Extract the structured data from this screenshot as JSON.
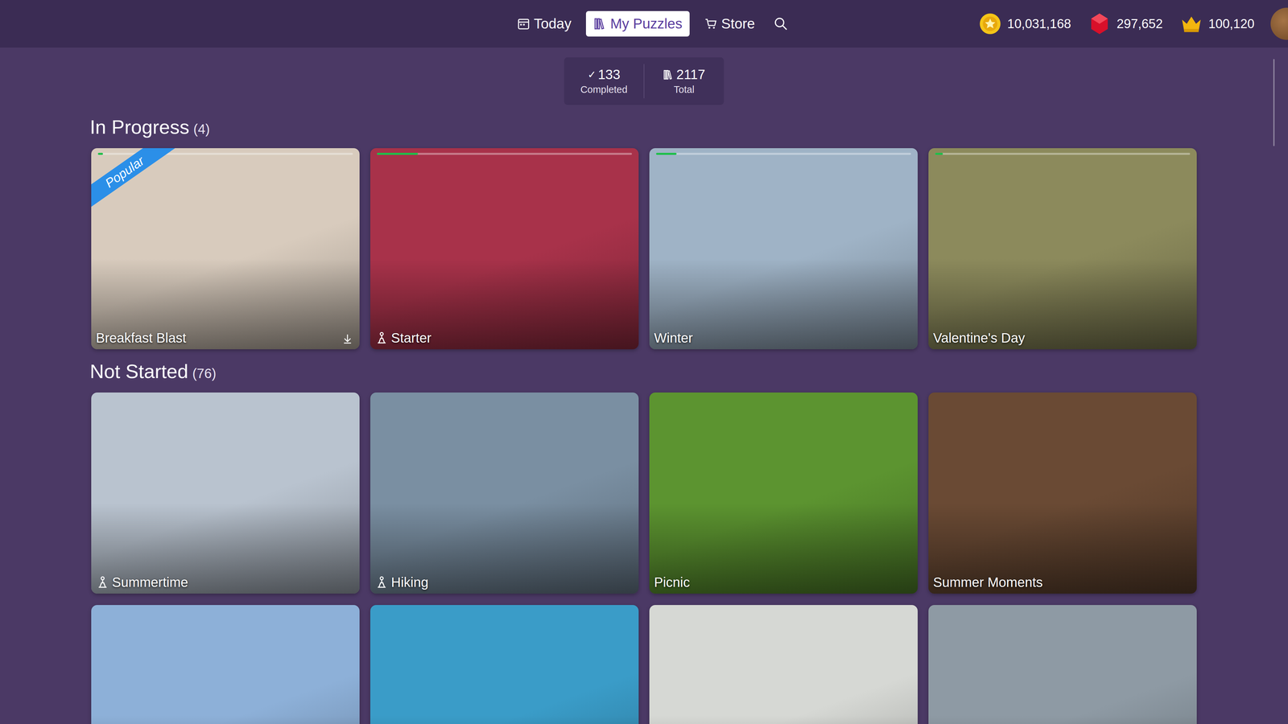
{
  "nav": {
    "tabs": [
      {
        "label": "Today",
        "selected": false
      },
      {
        "label": "My Puzzles",
        "selected": true
      },
      {
        "label": "Store",
        "selected": false
      }
    ]
  },
  "currencies": [
    {
      "kind": "coin",
      "value": "10,031,168"
    },
    {
      "kind": "gem",
      "value": "297,652"
    },
    {
      "kind": "crown",
      "value": "100,120"
    }
  ],
  "stats": [
    {
      "mark": "✓",
      "value": "133",
      "label": "Completed"
    },
    {
      "value": "2117",
      "label": "Total"
    }
  ],
  "sections": [
    {
      "title": "In Progress",
      "count": "(4)",
      "cards": [
        {
          "title": "Breakfast Blast",
          "level": 0.02,
          "badge": "Popular",
          "downloadable": true,
          "figure": false,
          "color": "#d8cbbd"
        },
        {
          "title": "Starter",
          "level": 0.16,
          "downloadable": false,
          "figure": true,
          "color": "#a8324a"
        },
        {
          "title": "Winter",
          "level": 0.08,
          "downloadable": false,
          "figure": false,
          "color": "#9fb3c6"
        },
        {
          "title": "Valentine's Day",
          "level": 0.03,
          "downloadable": false,
          "figure": false,
          "color": "#8c8a5c"
        }
      ]
    },
    {
      "title": "Not Started",
      "count": "(76)",
      "cards": [
        {
          "title": "Summertime",
          "downloadable": false,
          "figure": true,
          "color": "#b9c3cf"
        },
        {
          "title": "Hiking",
          "downloadable": false,
          "figure": true,
          "color": "#7a8fa2"
        },
        {
          "title": "Picnic",
          "downloadable": false,
          "figure": false,
          "color": "#5c9430"
        },
        {
          "title": "Summer Moments",
          "downloadable": false,
          "figure": false,
          "color": "#6a4a34"
        },
        {
          "downloadable": false,
          "figure": false,
          "color": "#8db0d8"
        },
        {
          "downloadable": false,
          "figure": false,
          "color": "#3a9cc8"
        },
        {
          "downloadable": false,
          "figure": false,
          "color": "#d6d8d4"
        },
        {
          "downloadable": false,
          "figure": false,
          "color": "#8e9aa4"
        }
      ]
    }
  ]
}
